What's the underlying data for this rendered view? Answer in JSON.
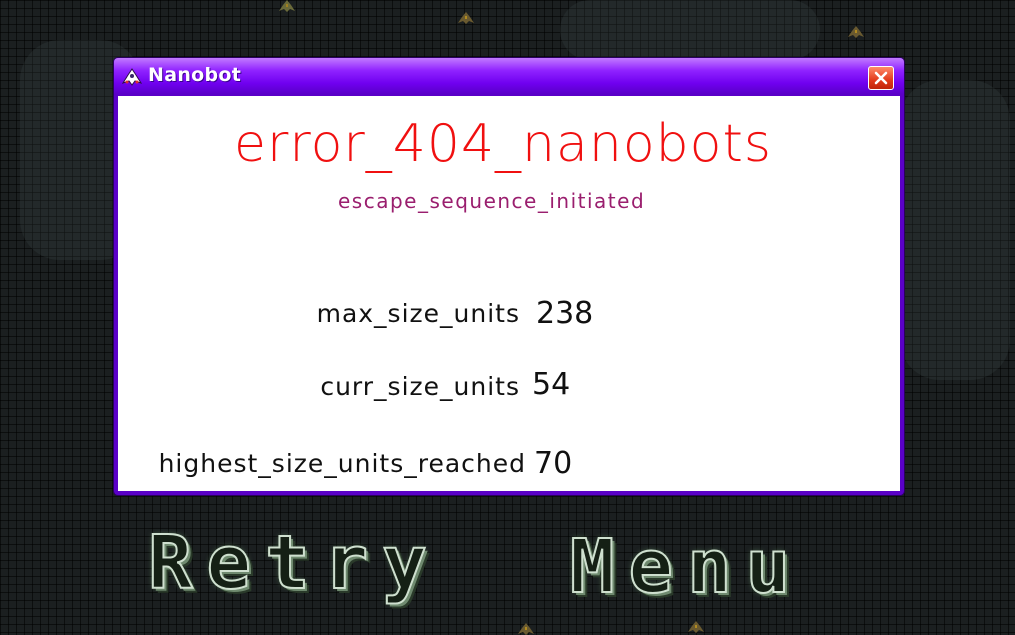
{
  "window": {
    "title": "Nanobot",
    "title_icon": "nanobot-ship-icon",
    "close_icon": "close-icon"
  },
  "dialog": {
    "heading": "error_404_nanobots",
    "subheading": "escape_sequence_initiated",
    "stats": [
      {
        "label": "max_size_units",
        "value": "238"
      },
      {
        "label": "curr_size_units",
        "value": "54"
      },
      {
        "label": "highest_size_units_reached",
        "value": "70"
      }
    ]
  },
  "buttons": {
    "retry": "Retry",
    "menu": "Menu"
  },
  "colors": {
    "titlebar": "#7000f0",
    "heading": "#f01010",
    "subheading": "#9a1e6e",
    "close_button": "#e23a1a"
  }
}
